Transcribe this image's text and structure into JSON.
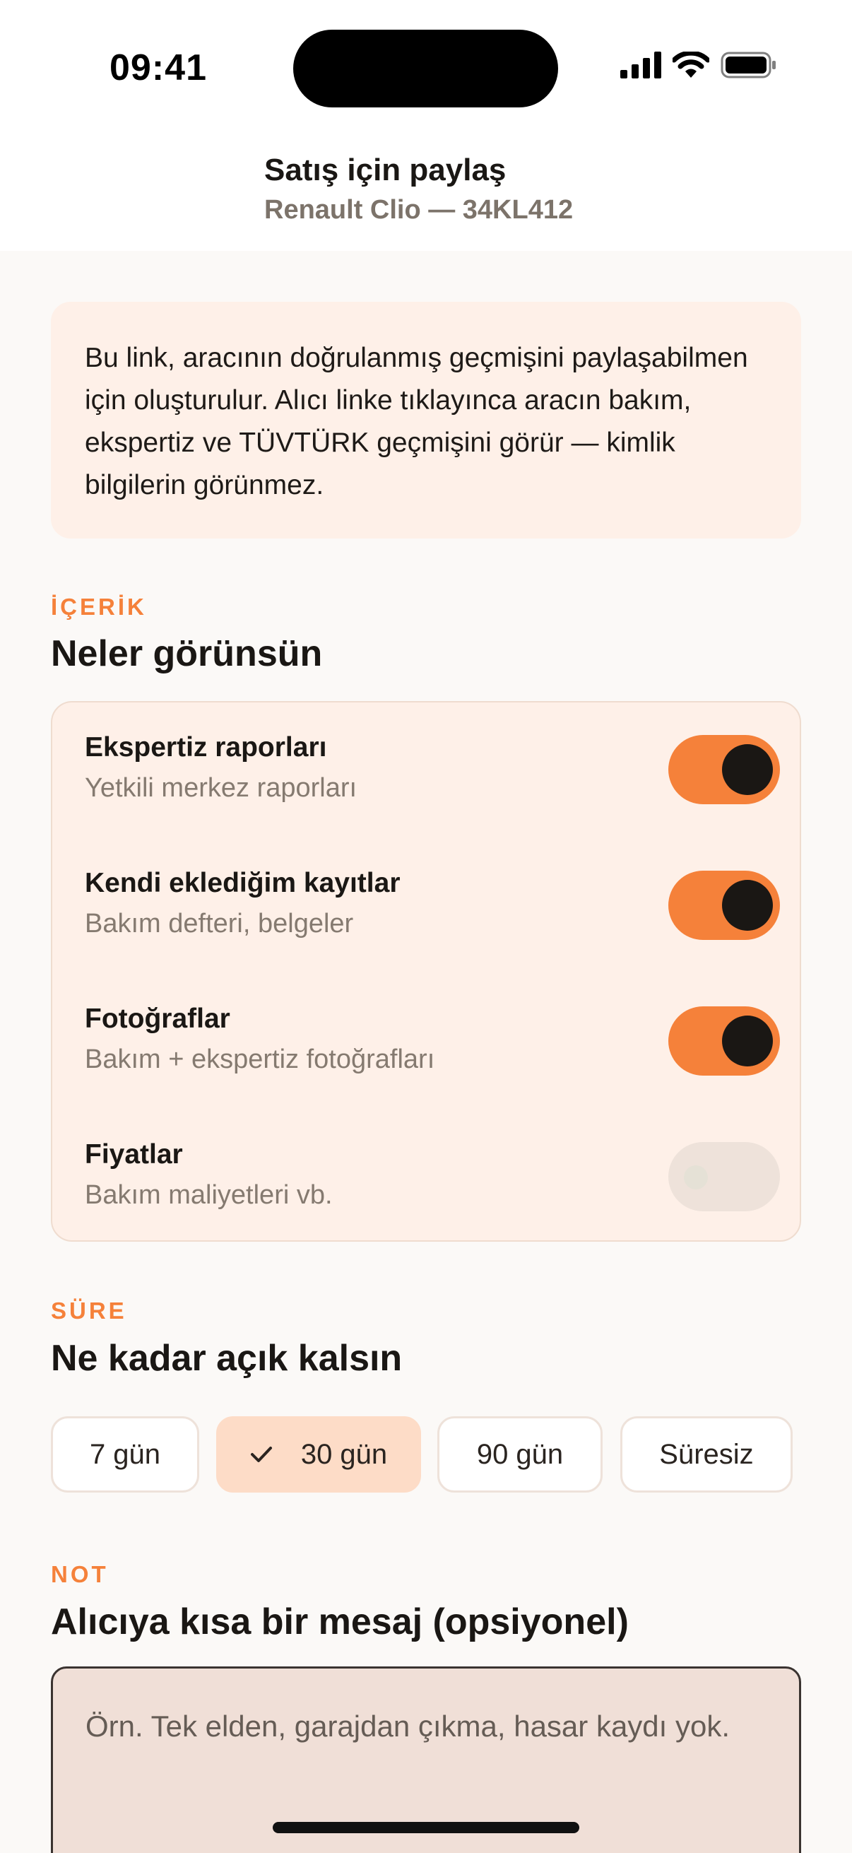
{
  "status_bar": {
    "time": "09:41",
    "icons": [
      "cellular-signal-icon",
      "wifi-icon",
      "battery-icon"
    ]
  },
  "header": {
    "title": "Satış için paylaş",
    "subtitle": "Renault Clio — 34KL412"
  },
  "info_card": {
    "text": "Bu link, aracının doğrulanmış geçmişini paylaşabilmen için oluşturulur. Alıcı linke tıklayınca aracın bakım, ekspertiz ve TÜVTÜRK geçmişini görür — kimlik bilgilerin görünmez."
  },
  "content_section": {
    "eyebrow": "İÇERİK",
    "title": "Neler görünsün",
    "items": [
      {
        "label": "Ekspertiz raporları",
        "description": "Yetkili merkez raporları",
        "enabled": true
      },
      {
        "label": "Kendi eklediğim kayıtlar",
        "description": "Bakım defteri, belgeler",
        "enabled": true
      },
      {
        "label": "Fotoğraflar",
        "description": "Bakım + ekspertiz fotoğrafları",
        "enabled": true
      },
      {
        "label": "Fiyatlar",
        "description": "Bakım maliyetleri vb.",
        "enabled": false
      }
    ]
  },
  "duration_section": {
    "eyebrow": "SÜRE",
    "title": "Ne kadar açık kalsın",
    "options": [
      "7 gün",
      "30 gün",
      "90 gün",
      "Süresiz"
    ],
    "selected": "30 gün"
  },
  "note_section": {
    "eyebrow": "NOT",
    "title": "Alıcıya kısa bir mesaj (opsiyonel)",
    "placeholder": "Örn. Tek elden, garajdan çıkma, hasar kaydı yok."
  },
  "colors": {
    "accent": "#F5813A",
    "card_background": "#FEF0E8",
    "selected_chip": "#FDDCC7",
    "text_primary": "#1A1714",
    "text_secondary": "#857A70"
  }
}
